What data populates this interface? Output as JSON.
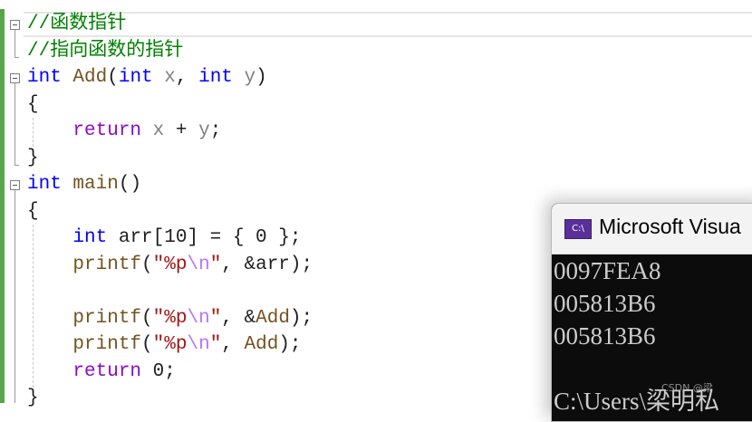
{
  "editor": {
    "lines": [
      {
        "tokens": [
          {
            "t": "//函数指针",
            "c": "cm"
          }
        ]
      },
      {
        "tokens": [
          {
            "t": "//指向函数的指针",
            "c": "cm"
          }
        ]
      },
      {
        "tokens": [
          {
            "t": "int",
            "c": "kw"
          },
          {
            "t": " ",
            "c": "txt"
          },
          {
            "t": "Add",
            "c": "fn"
          },
          {
            "t": "(",
            "c": "txt"
          },
          {
            "t": "int",
            "c": "kw"
          },
          {
            "t": " ",
            "c": "txt"
          },
          {
            "t": "x",
            "c": "param"
          },
          {
            "t": ", ",
            "c": "txt"
          },
          {
            "t": "int",
            "c": "kw"
          },
          {
            "t": " ",
            "c": "txt"
          },
          {
            "t": "y",
            "c": "param"
          },
          {
            "t": ")",
            "c": "txt"
          }
        ]
      },
      {
        "tokens": [
          {
            "t": "{",
            "c": "txt"
          }
        ]
      },
      {
        "tokens": [
          {
            "t": "    ",
            "c": "txt"
          },
          {
            "t": "return",
            "c": "ctl"
          },
          {
            "t": " ",
            "c": "txt"
          },
          {
            "t": "x",
            "c": "param"
          },
          {
            "t": " + ",
            "c": "txt"
          },
          {
            "t": "y",
            "c": "param"
          },
          {
            "t": ";",
            "c": "txt"
          }
        ]
      },
      {
        "tokens": [
          {
            "t": "}",
            "c": "txt"
          }
        ]
      },
      {
        "tokens": [
          {
            "t": "int",
            "c": "kw"
          },
          {
            "t": " ",
            "c": "txt"
          },
          {
            "t": "main",
            "c": "fn"
          },
          {
            "t": "()",
            "c": "txt"
          }
        ]
      },
      {
        "tokens": [
          {
            "t": "{",
            "c": "txt"
          }
        ]
      },
      {
        "tokens": [
          {
            "t": "    ",
            "c": "txt"
          },
          {
            "t": "int",
            "c": "kw"
          },
          {
            "t": " arr[10] = { 0 };",
            "c": "txt"
          }
        ]
      },
      {
        "tokens": [
          {
            "t": "    ",
            "c": "txt"
          },
          {
            "t": "printf",
            "c": "fn"
          },
          {
            "t": "(",
            "c": "txt"
          },
          {
            "t": "\"%p",
            "c": "str"
          },
          {
            "t": "\\n",
            "c": "esc"
          },
          {
            "t": "\"",
            "c": "str"
          },
          {
            "t": ", &arr);",
            "c": "txt"
          }
        ]
      },
      {
        "tokens": []
      },
      {
        "tokens": [
          {
            "t": "    ",
            "c": "txt"
          },
          {
            "t": "printf",
            "c": "fn"
          },
          {
            "t": "(",
            "c": "txt"
          },
          {
            "t": "\"%p",
            "c": "str"
          },
          {
            "t": "\\n",
            "c": "esc"
          },
          {
            "t": "\"",
            "c": "str"
          },
          {
            "t": ", &",
            "c": "txt"
          },
          {
            "t": "Add",
            "c": "fn"
          },
          {
            "t": ");",
            "c": "txt"
          }
        ]
      },
      {
        "tokens": [
          {
            "t": "    ",
            "c": "txt"
          },
          {
            "t": "printf",
            "c": "fn"
          },
          {
            "t": "(",
            "c": "txt"
          },
          {
            "t": "\"%p",
            "c": "str"
          },
          {
            "t": "\\n",
            "c": "esc"
          },
          {
            "t": "\"",
            "c": "str"
          },
          {
            "t": ", ",
            "c": "txt"
          },
          {
            "t": "Add",
            "c": "fn"
          },
          {
            "t": ");",
            "c": "txt"
          }
        ]
      },
      {
        "tokens": [
          {
            "t": "    ",
            "c": "txt"
          },
          {
            "t": "return",
            "c": "ctl"
          },
          {
            "t": " 0;",
            "c": "txt"
          }
        ]
      },
      {
        "tokens": [
          {
            "t": "}",
            "c": "txt"
          }
        ]
      }
    ]
  },
  "console": {
    "icon_label": "C:\\",
    "title": "Microsoft Visua",
    "output": [
      "0097FEA8",
      "005813B6",
      "005813B6",
      "",
      "C:\\Users\\梁明私"
    ]
  },
  "watermark": "CSDN @梁"
}
